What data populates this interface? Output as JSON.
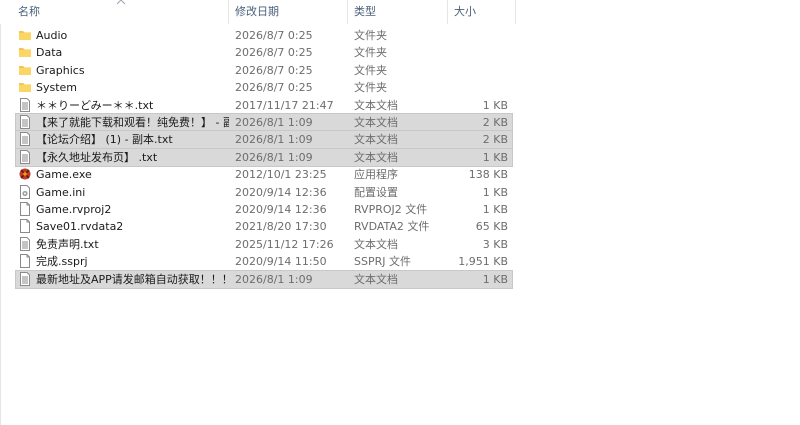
{
  "columns": {
    "name": "名称",
    "date": "修改日期",
    "type": "类型",
    "size": "大小"
  },
  "rows": [
    {
      "name": "Audio",
      "date": "2026/8/7 0:25",
      "type": "文件夹",
      "size": "",
      "icon": "folder-icon",
      "selected": false
    },
    {
      "name": "Data",
      "date": "2026/8/7 0:25",
      "type": "文件夹",
      "size": "",
      "icon": "folder-icon",
      "selected": false
    },
    {
      "name": "Graphics",
      "date": "2026/8/7 0:25",
      "type": "文件夹",
      "size": "",
      "icon": "folder-icon",
      "selected": false
    },
    {
      "name": "System",
      "date": "2026/8/7 0:25",
      "type": "文件夹",
      "size": "",
      "icon": "folder-icon",
      "selected": false
    },
    {
      "name": "＊＊りーどみー＊＊.txt",
      "date": "2017/11/17 21:47",
      "type": "文本文档",
      "size": "1 KB",
      "icon": "text-file-icon",
      "selected": false
    },
    {
      "name": "【来了就能下载和观看！纯免费！】 - 副...",
      "date": "2026/8/1 1:09",
      "type": "文本文档",
      "size": "2 KB",
      "icon": "text-file-icon",
      "selected": true
    },
    {
      "name": "【论坛介绍】 (1) - 副本.txt",
      "date": "2026/8/1 1:09",
      "type": "文本文档",
      "size": "2 KB",
      "icon": "text-file-icon",
      "selected": true
    },
    {
      "name": "【永久地址发布页】 .txt",
      "date": "2026/8/1 1:09",
      "type": "文本文档",
      "size": "1 KB",
      "icon": "text-file-icon",
      "selected": true
    },
    {
      "name": "Game.exe",
      "date": "2012/10/1 23:25",
      "type": "应用程序",
      "size": "138 KB",
      "icon": "game-exe-icon",
      "selected": false
    },
    {
      "name": "Game.ini",
      "date": "2020/9/14 12:36",
      "type": "配置设置",
      "size": "1 KB",
      "icon": "settings-file-icon",
      "selected": false
    },
    {
      "name": "Game.rvproj2",
      "date": "2020/9/14 12:36",
      "type": "RVPROJ2 文件",
      "size": "1 KB",
      "icon": "blank-file-icon",
      "selected": false
    },
    {
      "name": "Save01.rvdata2",
      "date": "2021/8/20 17:30",
      "type": "RVDATA2 文件",
      "size": "65 KB",
      "icon": "blank-file-icon",
      "selected": false
    },
    {
      "name": "免责声明.txt",
      "date": "2025/11/12 17:26",
      "type": "文本文档",
      "size": "3 KB",
      "icon": "text-file-icon",
      "selected": false
    },
    {
      "name": "完成.ssprj",
      "date": "2020/9/14 11:50",
      "type": "SSPRJ 文件",
      "size": "1,951 KB",
      "icon": "blank-file-icon",
      "selected": false
    },
    {
      "name": "最新地址及APP请发邮箱自动获取！！！...",
      "date": "2026/8/1 1:09",
      "type": "文本文档",
      "size": "1 KB",
      "icon": "text-file-icon",
      "selected": true
    }
  ],
  "colors": {
    "selection": "#d9d9d9",
    "header_text": "#4c607a",
    "folder": "#f4c54b"
  }
}
